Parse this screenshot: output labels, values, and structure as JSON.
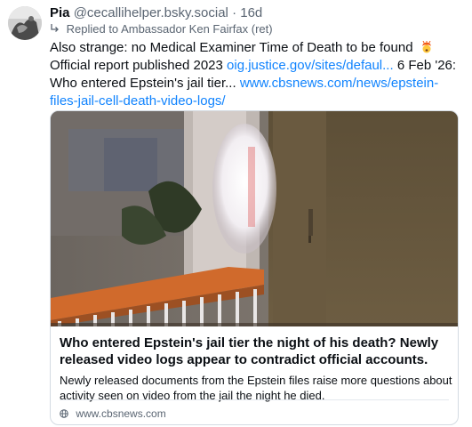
{
  "post": {
    "display_name": "Pia",
    "handle": "@cecallihelper.bsky.social",
    "separator": "·",
    "time": "16d",
    "reply_prefix": "Replied to",
    "reply_to": "Ambassador Ken Fairfax (ret)",
    "text_part1": "Also strange: no Medical Examiner Time of Death to be found",
    "emoji_icon": "mind-blown-emoji",
    "text_part2": "Official report published 2023",
    "link1": "oig.justice.gov/sites/defaul...",
    "text_part3": "6 Feb '26: Who entered Epstein's jail tier...",
    "link2": "www.cbsnews.com/news/epstein-files-jail-cell-death-video-logs/"
  },
  "embed": {
    "title": "Who entered Epstein's jail tier the night of his death? Newly released video logs appear to contradict official accounts.",
    "description": "Newly released documents from the Epstein files raise more questions about activity seen on video from the jail the night he died.",
    "domain": "www.cbsnews.com",
    "domain_icon": "globe-icon"
  },
  "colors": {
    "link": "#1083fe",
    "secondary_text": "#5a6572",
    "border": "#d4dbe2"
  }
}
